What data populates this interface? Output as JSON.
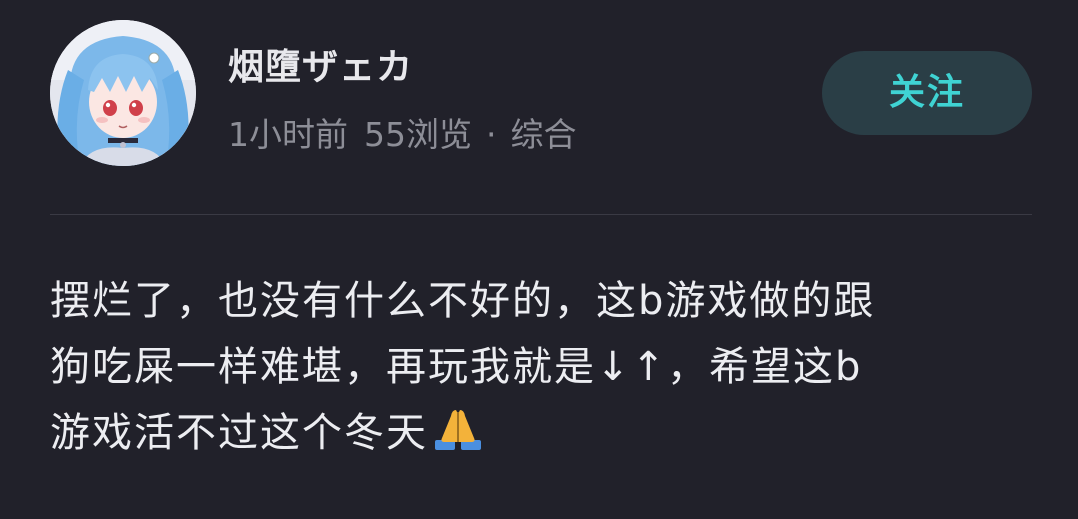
{
  "author": {
    "name": "烟墮ザェカ",
    "avatar_icon": "anime-avatar-icon"
  },
  "meta": {
    "time": "1小时前",
    "views": "55浏览",
    "separator": "·",
    "category": "综合"
  },
  "follow_button": {
    "label": "关注",
    "bg_color": "#2a3e46",
    "text_color": "#3fd3d3"
  },
  "post": {
    "lines": [
      "摆烂了，也没有什么不好的，这b游戏做的跟",
      "狗吃屎一样难堪，再玩我就是↓↑，希望这b",
      "游戏活不过这个冬天"
    ],
    "emoji_icon": "folded-hands-icon"
  },
  "colors": {
    "background": "#21212a",
    "primary_text": "#ecedf1",
    "secondary_text": "#8d8e97"
  }
}
